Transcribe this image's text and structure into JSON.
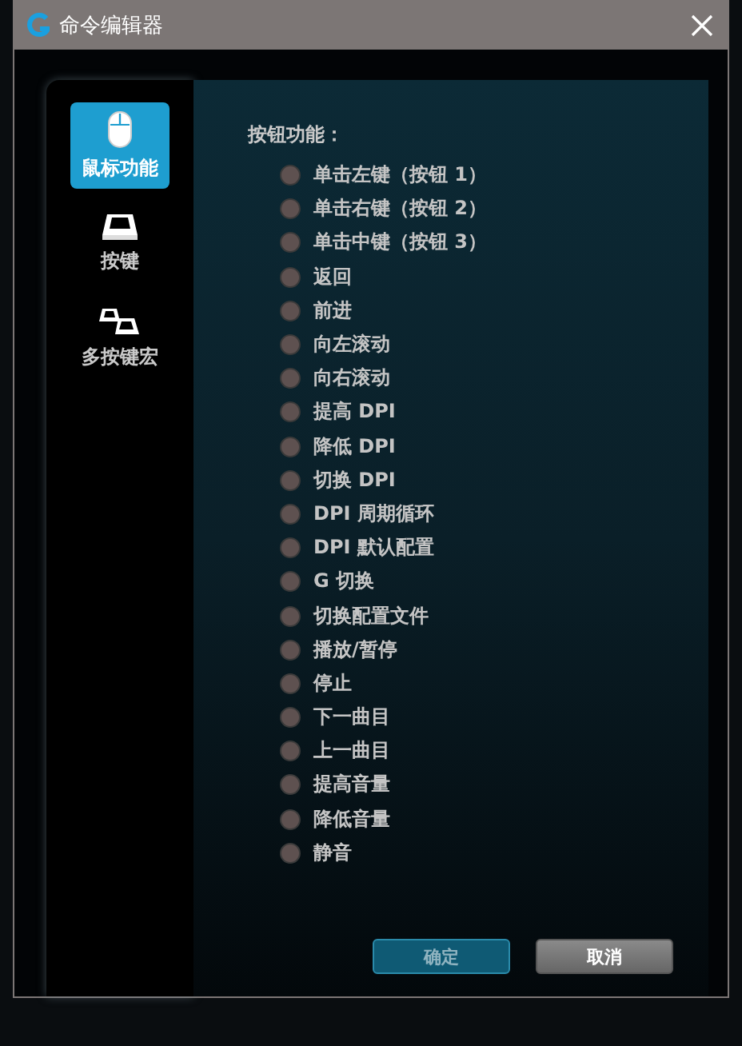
{
  "window": {
    "title": "命令编辑器"
  },
  "sidebar": {
    "items": [
      {
        "kind": "mouse",
        "label": "鼠标功能",
        "selected": true
      },
      {
        "kind": "key",
        "label": "按键",
        "selected": false
      },
      {
        "kind": "multikey",
        "label": "多按键宏",
        "selected": false
      }
    ]
  },
  "section_label": "按钮功能：",
  "options": [
    {
      "label": "单击左键（按钮 1）",
      "selected": false
    },
    {
      "label": "单击右键（按钮 2）",
      "selected": false
    },
    {
      "label": "单击中键（按钮 3）",
      "selected": false
    },
    {
      "label": "返回",
      "selected": false
    },
    {
      "label": "前进",
      "selected": false
    },
    {
      "label": "向左滚动",
      "selected": false
    },
    {
      "label": "向右滚动",
      "selected": false
    },
    {
      "label": "提高 DPI",
      "selected": false
    },
    {
      "label": "降低 DPI",
      "selected": false
    },
    {
      "label": "切换 DPI",
      "selected": false
    },
    {
      "label": "DPI 周期循环",
      "selected": false
    },
    {
      "label": "DPI 默认配置",
      "selected": false
    },
    {
      "label": "G 切换",
      "selected": false
    },
    {
      "label": "切换配置文件",
      "selected": false
    },
    {
      "label": "播放/暂停",
      "selected": false
    },
    {
      "label": "停止",
      "selected": false
    },
    {
      "label": "下一曲目",
      "selected": false
    },
    {
      "label": "上一曲目",
      "selected": false
    },
    {
      "label": "提高音量",
      "selected": false
    },
    {
      "label": "降低音量",
      "selected": false
    },
    {
      "label": "静音",
      "selected": false
    }
  ],
  "buttons": [
    {
      "kind": "primary",
      "label": "确定"
    },
    {
      "kind": "secondary",
      "label": "取消"
    }
  ]
}
